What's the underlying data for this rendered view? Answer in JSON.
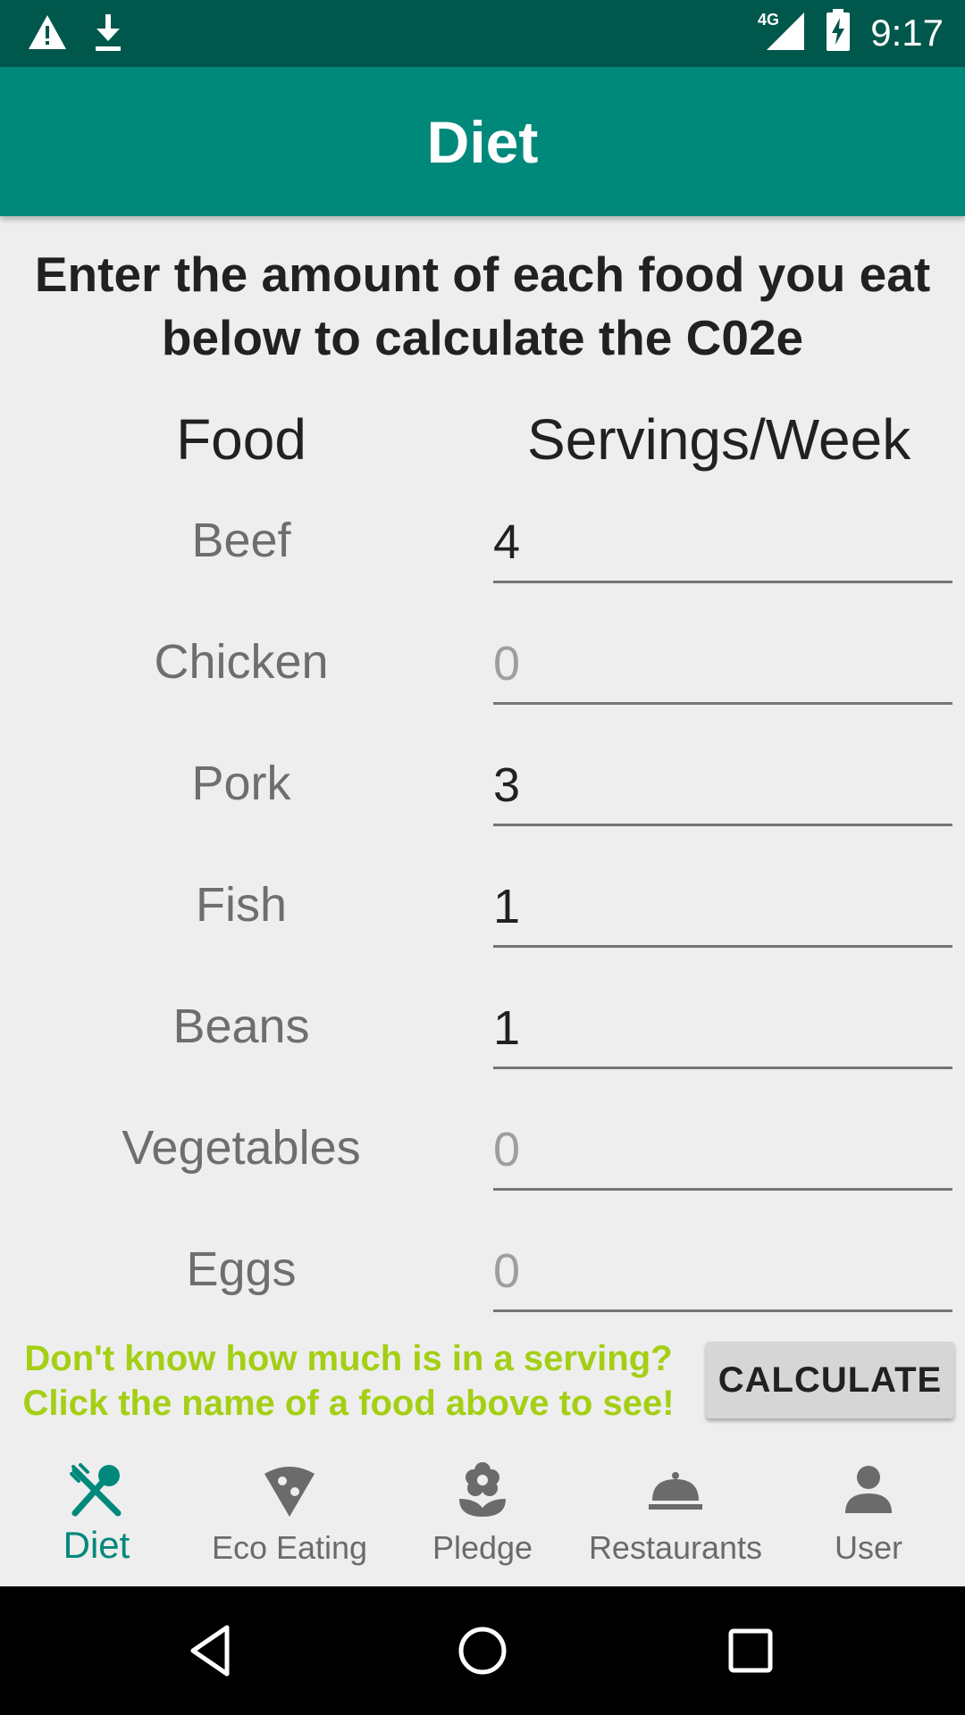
{
  "status_bar": {
    "time": "9:17",
    "network": "4G",
    "left_icons": [
      "warning-icon",
      "download-icon"
    ],
    "right_icons": [
      "signal-icon",
      "battery-charging-icon"
    ]
  },
  "app_bar": {
    "title": "Diet"
  },
  "intro": {
    "line1": "Enter the amount of each food you eat",
    "line2": "below to calculate the C02e"
  },
  "table": {
    "food_header": "Food",
    "servings_header": "Servings/Week",
    "rows": [
      {
        "food": "Beef",
        "value": "4",
        "placeholder": "0"
      },
      {
        "food": "Chicken",
        "value": "",
        "placeholder": "0"
      },
      {
        "food": "Pork",
        "value": "3",
        "placeholder": "0"
      },
      {
        "food": "Fish",
        "value": "1",
        "placeholder": "0"
      },
      {
        "food": "Beans",
        "value": "1",
        "placeholder": "0"
      },
      {
        "food": "Vegetables",
        "value": "",
        "placeholder": "0"
      },
      {
        "food": "Eggs",
        "value": "",
        "placeholder": "0"
      }
    ]
  },
  "hint": {
    "line1": "Don't know how much is in a serving?",
    "line2": "Click the name of a food above to see!"
  },
  "calculate_label": "CALCULATE",
  "bottom_nav": {
    "items": [
      {
        "label": "Diet",
        "icon": "fork-spoon-icon",
        "active": true
      },
      {
        "label": "Eco Eating",
        "icon": "pizza-slice-icon",
        "active": false
      },
      {
        "label": "Pledge",
        "icon": "flower-icon",
        "active": false
      },
      {
        "label": "Restaurants",
        "icon": "room-service-icon",
        "active": false
      },
      {
        "label": "User",
        "icon": "person-icon",
        "active": false
      }
    ]
  },
  "colors": {
    "status_bar": "#00574b",
    "app_bar": "#00897b",
    "accent": "#00897b",
    "hint": "#a4cf14",
    "background": "#eeeeee"
  },
  "system_nav": {
    "icons": [
      "back-icon",
      "home-icon",
      "recents-icon"
    ]
  }
}
